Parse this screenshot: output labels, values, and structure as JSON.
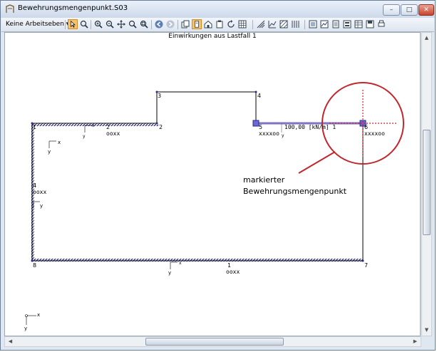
{
  "window": {
    "title": "Bewehrungsmengenpunkt.S03",
    "minimize_glyph": "–",
    "maximize_glyph": "□",
    "close_glyph": "✕"
  },
  "toolbar": {
    "layer_combo_value": "Keine Arbeitseben",
    "icons": [
      "select-arrow-icon",
      "zoom-select-icon",
      "zoom-in-icon",
      "zoom-out-icon",
      "pan-icon",
      "zoom-all-icon",
      "zoom-window-icon",
      "layers-icon",
      "view-icon",
      "home-icon",
      "paste-icon",
      "rotate-icon",
      "grid-icon",
      "back-icon",
      "forward-icon",
      "rulers-icon",
      "graph-icon",
      "pattern-icon",
      "stripes-icon",
      "frame-icon",
      "chart-icon",
      "sheet-icon",
      "list-icon",
      "table-icon",
      "save-icon"
    ]
  },
  "canvas": {
    "caption": "Einwirkungen aus Lastfall 1",
    "nodes": [
      "1",
      "2",
      "3",
      "4",
      "5",
      "6",
      "7",
      "8"
    ],
    "edge_labels": {
      "top_left_number": "2",
      "top_left_value": "ooxx",
      "left_number": "4",
      "left_value": "ooxx",
      "bottom_number": "1",
      "bottom_value": "ooxx",
      "node5_value": "xxxxoo",
      "node6_value": "xxxxoo"
    },
    "load_label": "100,00 [kN/m] 1",
    "axis_x": "x",
    "axis_y": "y",
    "annotation": [
      "markierter",
      "Bewehrungsmengenpunkt"
    ],
    "colors": {
      "structure": "#000000",
      "support_hatch": "#1a1a8c",
      "load_line": "#7f73c6",
      "marker": "#c0272d"
    }
  },
  "scroll": {
    "up_glyph": "▲",
    "down_glyph": "▼",
    "left_glyph": "◀",
    "right_glyph": "▶"
  }
}
